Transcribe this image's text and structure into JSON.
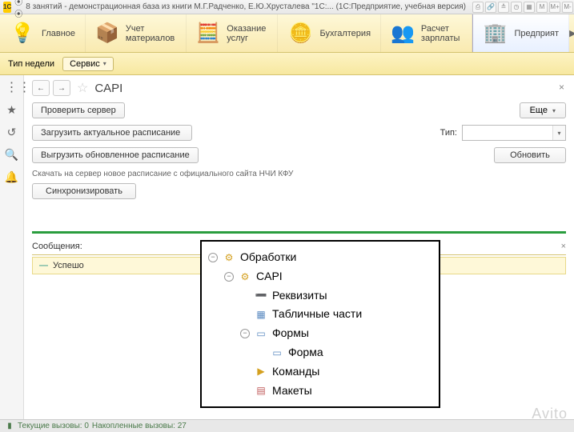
{
  "titlebar": {
    "logo_text": "1C",
    "nav_dots": "⦿ ⦿",
    "title": "8 занятий - демонстрационная база из книги М.Г.Радченко, Е.Ю.Хрусталева \"1С:... (1С:Предприятие, учебная версия)",
    "info": "i"
  },
  "sections": [
    {
      "icon": "💡",
      "label": "Главное",
      "cls": "ic-lamp"
    },
    {
      "icon": "📦",
      "label": "Учет материалов",
      "cls": "ic-box"
    },
    {
      "icon": "🧮",
      "label": "Оказание услуг",
      "cls": "ic-cash"
    },
    {
      "icon": "🪙",
      "label": "Бухгалтерия",
      "cls": "ic-coins"
    },
    {
      "icon": "👥",
      "label": "Расчет зарплаты",
      "cls": "ic-people"
    },
    {
      "icon": "🏢",
      "label": "Предприят",
      "cls": "ic-building",
      "active": true
    }
  ],
  "subtoolbar": {
    "week_type": "Тип недели",
    "service": "Сервис"
  },
  "page": {
    "title": "CAPI",
    "check_server": "Проверить сервер",
    "more": "Еще",
    "load_schedule": "Загрузить актуальное расписание",
    "unload_schedule": "Выгрузить обновленное расписание",
    "tip_label": "Тип:",
    "tip_value": "",
    "refresh": "Обновить",
    "desc": "Скачать на сервер новое расписание с официального сайта НЧИ КФУ",
    "sync": "Синхронизировать",
    "messages_header": "Сообщения:",
    "message_text": "Успешо"
  },
  "statusbar": {
    "current_calls": "Текущие вызовы: 0",
    "accumulated_calls": "Накопленные вызовы: 27"
  },
  "tree": [
    {
      "level": 0,
      "exp": "−",
      "icon": "⚙",
      "iconcolor": "#d4a020",
      "label": "Обработки"
    },
    {
      "level": 1,
      "exp": "−",
      "icon": "⚙",
      "iconcolor": "#d4a020",
      "label": "CAPI"
    },
    {
      "level": 2,
      "exp": "",
      "icon": "➖",
      "iconcolor": "#5a8ac0",
      "label": "Реквизиты"
    },
    {
      "level": 2,
      "exp": "",
      "icon": "▦",
      "iconcolor": "#5a8ac0",
      "label": "Табличные части"
    },
    {
      "level": 2,
      "exp": "−",
      "icon": "▭",
      "iconcolor": "#5a8ac0",
      "label": "Формы"
    },
    {
      "level": 3,
      "exp": "",
      "icon": "▭",
      "iconcolor": "#5a8ac0",
      "label": "Форма"
    },
    {
      "level": 2,
      "exp": "",
      "icon": "▶",
      "iconcolor": "#d4a020",
      "label": "Команды"
    },
    {
      "level": 2,
      "exp": "",
      "icon": "▤",
      "iconcolor": "#c05a5a",
      "label": "Макеты"
    }
  ],
  "watermark": "Avito"
}
